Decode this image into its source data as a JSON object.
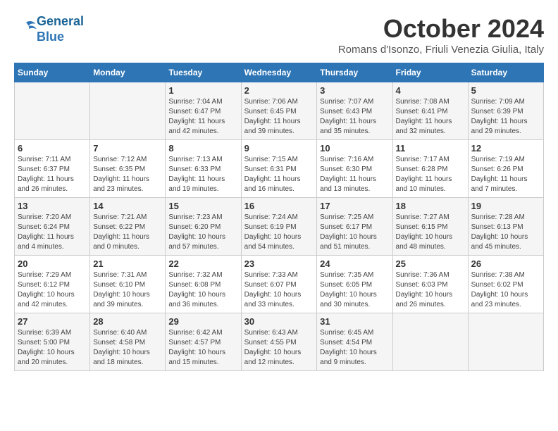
{
  "logo": {
    "line1": "General",
    "line2": "Blue"
  },
  "title": "October 2024",
  "subtitle": "Romans d'Isonzo, Friuli Venezia Giulia, Italy",
  "days_of_week": [
    "Sunday",
    "Monday",
    "Tuesday",
    "Wednesday",
    "Thursday",
    "Friday",
    "Saturday"
  ],
  "weeks": [
    [
      {
        "day": "",
        "info": ""
      },
      {
        "day": "",
        "info": ""
      },
      {
        "day": "1",
        "info": "Sunrise: 7:04 AM\nSunset: 6:47 PM\nDaylight: 11 hours and 42 minutes."
      },
      {
        "day": "2",
        "info": "Sunrise: 7:06 AM\nSunset: 6:45 PM\nDaylight: 11 hours and 39 minutes."
      },
      {
        "day": "3",
        "info": "Sunrise: 7:07 AM\nSunset: 6:43 PM\nDaylight: 11 hours and 35 minutes."
      },
      {
        "day": "4",
        "info": "Sunrise: 7:08 AM\nSunset: 6:41 PM\nDaylight: 11 hours and 32 minutes."
      },
      {
        "day": "5",
        "info": "Sunrise: 7:09 AM\nSunset: 6:39 PM\nDaylight: 11 hours and 29 minutes."
      }
    ],
    [
      {
        "day": "6",
        "info": "Sunrise: 7:11 AM\nSunset: 6:37 PM\nDaylight: 11 hours and 26 minutes."
      },
      {
        "day": "7",
        "info": "Sunrise: 7:12 AM\nSunset: 6:35 PM\nDaylight: 11 hours and 23 minutes."
      },
      {
        "day": "8",
        "info": "Sunrise: 7:13 AM\nSunset: 6:33 PM\nDaylight: 11 hours and 19 minutes."
      },
      {
        "day": "9",
        "info": "Sunrise: 7:15 AM\nSunset: 6:31 PM\nDaylight: 11 hours and 16 minutes."
      },
      {
        "day": "10",
        "info": "Sunrise: 7:16 AM\nSunset: 6:30 PM\nDaylight: 11 hours and 13 minutes."
      },
      {
        "day": "11",
        "info": "Sunrise: 7:17 AM\nSunset: 6:28 PM\nDaylight: 11 hours and 10 minutes."
      },
      {
        "day": "12",
        "info": "Sunrise: 7:19 AM\nSunset: 6:26 PM\nDaylight: 11 hours and 7 minutes."
      }
    ],
    [
      {
        "day": "13",
        "info": "Sunrise: 7:20 AM\nSunset: 6:24 PM\nDaylight: 11 hours and 4 minutes."
      },
      {
        "day": "14",
        "info": "Sunrise: 7:21 AM\nSunset: 6:22 PM\nDaylight: 11 hours and 0 minutes."
      },
      {
        "day": "15",
        "info": "Sunrise: 7:23 AM\nSunset: 6:20 PM\nDaylight: 10 hours and 57 minutes."
      },
      {
        "day": "16",
        "info": "Sunrise: 7:24 AM\nSunset: 6:19 PM\nDaylight: 10 hours and 54 minutes."
      },
      {
        "day": "17",
        "info": "Sunrise: 7:25 AM\nSunset: 6:17 PM\nDaylight: 10 hours and 51 minutes."
      },
      {
        "day": "18",
        "info": "Sunrise: 7:27 AM\nSunset: 6:15 PM\nDaylight: 10 hours and 48 minutes."
      },
      {
        "day": "19",
        "info": "Sunrise: 7:28 AM\nSunset: 6:13 PM\nDaylight: 10 hours and 45 minutes."
      }
    ],
    [
      {
        "day": "20",
        "info": "Sunrise: 7:29 AM\nSunset: 6:12 PM\nDaylight: 10 hours and 42 minutes."
      },
      {
        "day": "21",
        "info": "Sunrise: 7:31 AM\nSunset: 6:10 PM\nDaylight: 10 hours and 39 minutes."
      },
      {
        "day": "22",
        "info": "Sunrise: 7:32 AM\nSunset: 6:08 PM\nDaylight: 10 hours and 36 minutes."
      },
      {
        "day": "23",
        "info": "Sunrise: 7:33 AM\nSunset: 6:07 PM\nDaylight: 10 hours and 33 minutes."
      },
      {
        "day": "24",
        "info": "Sunrise: 7:35 AM\nSunset: 6:05 PM\nDaylight: 10 hours and 30 minutes."
      },
      {
        "day": "25",
        "info": "Sunrise: 7:36 AM\nSunset: 6:03 PM\nDaylight: 10 hours and 26 minutes."
      },
      {
        "day": "26",
        "info": "Sunrise: 7:38 AM\nSunset: 6:02 PM\nDaylight: 10 hours and 23 minutes."
      }
    ],
    [
      {
        "day": "27",
        "info": "Sunrise: 6:39 AM\nSunset: 5:00 PM\nDaylight: 10 hours and 20 minutes."
      },
      {
        "day": "28",
        "info": "Sunrise: 6:40 AM\nSunset: 4:58 PM\nDaylight: 10 hours and 18 minutes."
      },
      {
        "day": "29",
        "info": "Sunrise: 6:42 AM\nSunset: 4:57 PM\nDaylight: 10 hours and 15 minutes."
      },
      {
        "day": "30",
        "info": "Sunrise: 6:43 AM\nSunset: 4:55 PM\nDaylight: 10 hours and 12 minutes."
      },
      {
        "day": "31",
        "info": "Sunrise: 6:45 AM\nSunset: 4:54 PM\nDaylight: 10 hours and 9 minutes."
      },
      {
        "day": "",
        "info": ""
      },
      {
        "day": "",
        "info": ""
      }
    ]
  ]
}
